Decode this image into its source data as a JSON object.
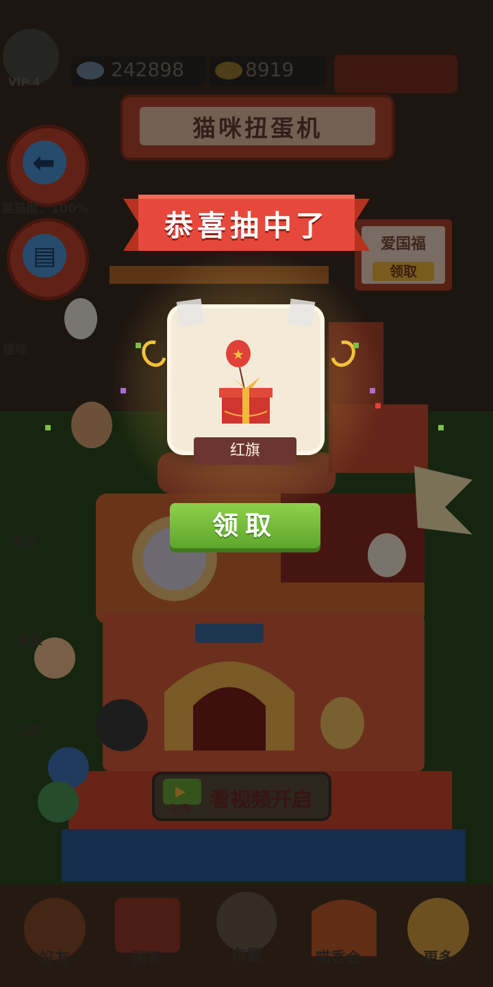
{
  "hud": {
    "vip_label": "VIP 4",
    "fish_count": "242898",
    "coin_count": "8919"
  },
  "machine": {
    "title": "猫咪扭蛋机",
    "video_button_label": "看视频开启",
    "video_progress": "3/5"
  },
  "left_panel": {
    "progress_label": "猫猫度：100%",
    "items": [
      {
        "label": "猫咪",
        "icon": "cat-face-icon"
      },
      {
        "label": "寿司",
        "icon": "sushi-icon"
      },
      {
        "label": "免费",
        "icon": "tv-icon"
      },
      {
        "label": "立即",
        "icon": "gift-icon"
      }
    ]
  },
  "right_sign": {
    "title": "爱国福",
    "claim_label": "领取"
  },
  "popup": {
    "banner": "恭喜抽中了",
    "item_name": "红旗",
    "claim_label": "领取",
    "item_icon": "red-gift-box-with-balloon-icon"
  },
  "bottom_nav": [
    {
      "label": "好友",
      "icon": "cat-friend-icon"
    },
    {
      "label": "图鉴",
      "icon": "book-icon"
    },
    {
      "label": "布置",
      "icon": "bag-icon"
    },
    {
      "label": "喵委会",
      "icon": "cat-council-icon"
    },
    {
      "label": "更多",
      "icon": "question-icon"
    }
  ],
  "colors": {
    "banner_red": "#e6493b",
    "claim_green": "#72bb3a",
    "card_cream": "#f4ead8",
    "name_plate": "#6b3530"
  }
}
